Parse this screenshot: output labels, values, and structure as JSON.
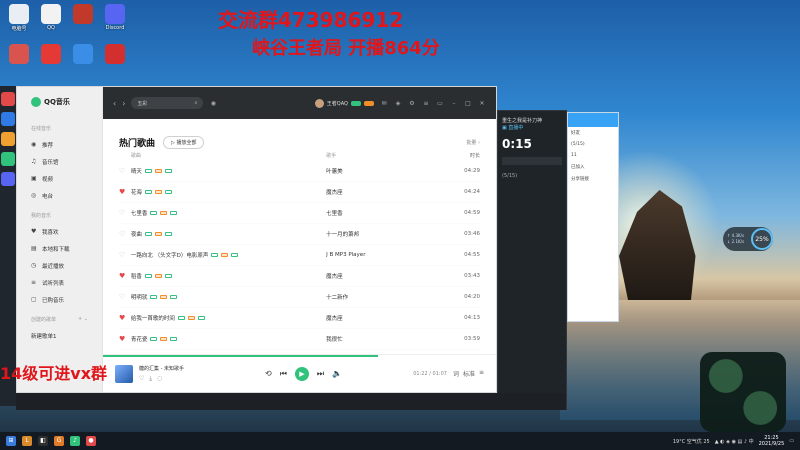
{
  "overlay": {
    "line1": "交流群473986912",
    "line2": "峡谷王者局  开播864分",
    "line3": "14级可进vx群"
  },
  "desktop_icons": [
    {
      "label": "电脑号",
      "color": "#e9eef5",
      "icon": "computer-icon"
    },
    {
      "label": "QQ",
      "color": "#f2f2f2",
      "icon": "qq-icon"
    },
    {
      "label": "",
      "color": "#c0392b",
      "icon": "game-launcher-icon"
    },
    {
      "label": "Discord",
      "color": "#5865f2",
      "icon": "discord-icon"
    },
    {
      "label": "",
      "color": "#d9534f",
      "icon": "app-icon"
    },
    {
      "label": "",
      "color": "#e53935",
      "icon": "music-app-icon"
    },
    {
      "label": "",
      "color": "#3b8ee6",
      "icon": "qq-contact-icon"
    },
    {
      "label": "",
      "color": "#d32f2f",
      "icon": "red-app-icon"
    }
  ],
  "qqmusic": {
    "app_name": "QQ音乐",
    "sidebar": {
      "section1": "在线音乐",
      "items1": [
        {
          "label": "推荐",
          "icon": "recommend-icon",
          "glyph": "◉"
        },
        {
          "label": "音乐馆",
          "icon": "music-hall-icon",
          "glyph": "♫"
        },
        {
          "label": "视频",
          "icon": "video-icon",
          "glyph": "▣"
        },
        {
          "label": "电台",
          "icon": "radio-icon",
          "glyph": "◎"
        }
      ],
      "section2": "我的音乐",
      "items2": [
        {
          "label": "我喜欢",
          "icon": "heart-icon",
          "glyph": "♥"
        },
        {
          "label": "本地和下载",
          "icon": "download-icon",
          "glyph": "▤"
        },
        {
          "label": "最近播放",
          "icon": "history-icon",
          "glyph": "◷"
        },
        {
          "label": "试听列表",
          "icon": "list-icon",
          "glyph": "≡"
        },
        {
          "label": "已购音乐",
          "icon": "bag-icon",
          "glyph": "▢"
        }
      ],
      "section3": "创建的歌单",
      "items3": [
        {
          "label": "新建歌单1"
        }
      ]
    },
    "topbar": {
      "search_value": "五彩",
      "user_name": "王者QAQ"
    },
    "section_title": "热门歌曲",
    "play_all": "播放全部",
    "manage": "批量 ›",
    "columns": {
      "title": "歌曲",
      "artist": "歌手",
      "time": "时长"
    },
    "songs": [
      {
        "title": "晴天",
        "artist": "叶蕙美",
        "time": "04:29",
        "liked": false
      },
      {
        "title": "花海",
        "artist": "魔杰座",
        "time": "04:24",
        "liked": true
      },
      {
        "title": "七里香",
        "artist": "七里香",
        "time": "04:59",
        "liked": false
      },
      {
        "title": "夜曲",
        "artist": "十一月的萧邦",
        "time": "03:46",
        "liked": false
      },
      {
        "title": "一路向北 （头文字D）电影原声",
        "artist": "J B MP3 Player",
        "time": "04:55",
        "liked": false
      },
      {
        "title": "稻香",
        "artist": "魔杰座",
        "time": "03:43",
        "liked": true
      },
      {
        "title": "明明就",
        "artist": "十二新作",
        "time": "04:20",
        "liked": false
      },
      {
        "title": "给我一首歌的时间",
        "artist": "魔杰座",
        "time": "04:13",
        "liked": true
      },
      {
        "title": "青花瓷",
        "artist": "我很忙",
        "time": "03:59",
        "liked": true
      },
      {
        "title": "告白气球",
        "artist": "周杰伦的床边故事",
        "time": "03:35",
        "liked": false
      }
    ],
    "player": {
      "title": "糖的汇集 - 未知歌手",
      "time": "01:22 / 01:07",
      "quality": "标准",
      "progress": 0.7
    }
  },
  "stream": {
    "header": "重生之我是补刀神",
    "sub": "▣ 直播中",
    "clock": "0:15",
    "count": "(5/15)"
  },
  "chat": {
    "lines": [
      "好友",
      "(5/15)",
      "11",
      "已加入",
      "分享链接"
    ]
  },
  "speed": {
    "up": "↑ 4.3K/s",
    "down": "↓ 2.1K/s",
    "pct": "25%"
  },
  "taskbar": {
    "weather": "19°C 空气优 25",
    "time": "21:25",
    "date": "2021/9/25"
  }
}
